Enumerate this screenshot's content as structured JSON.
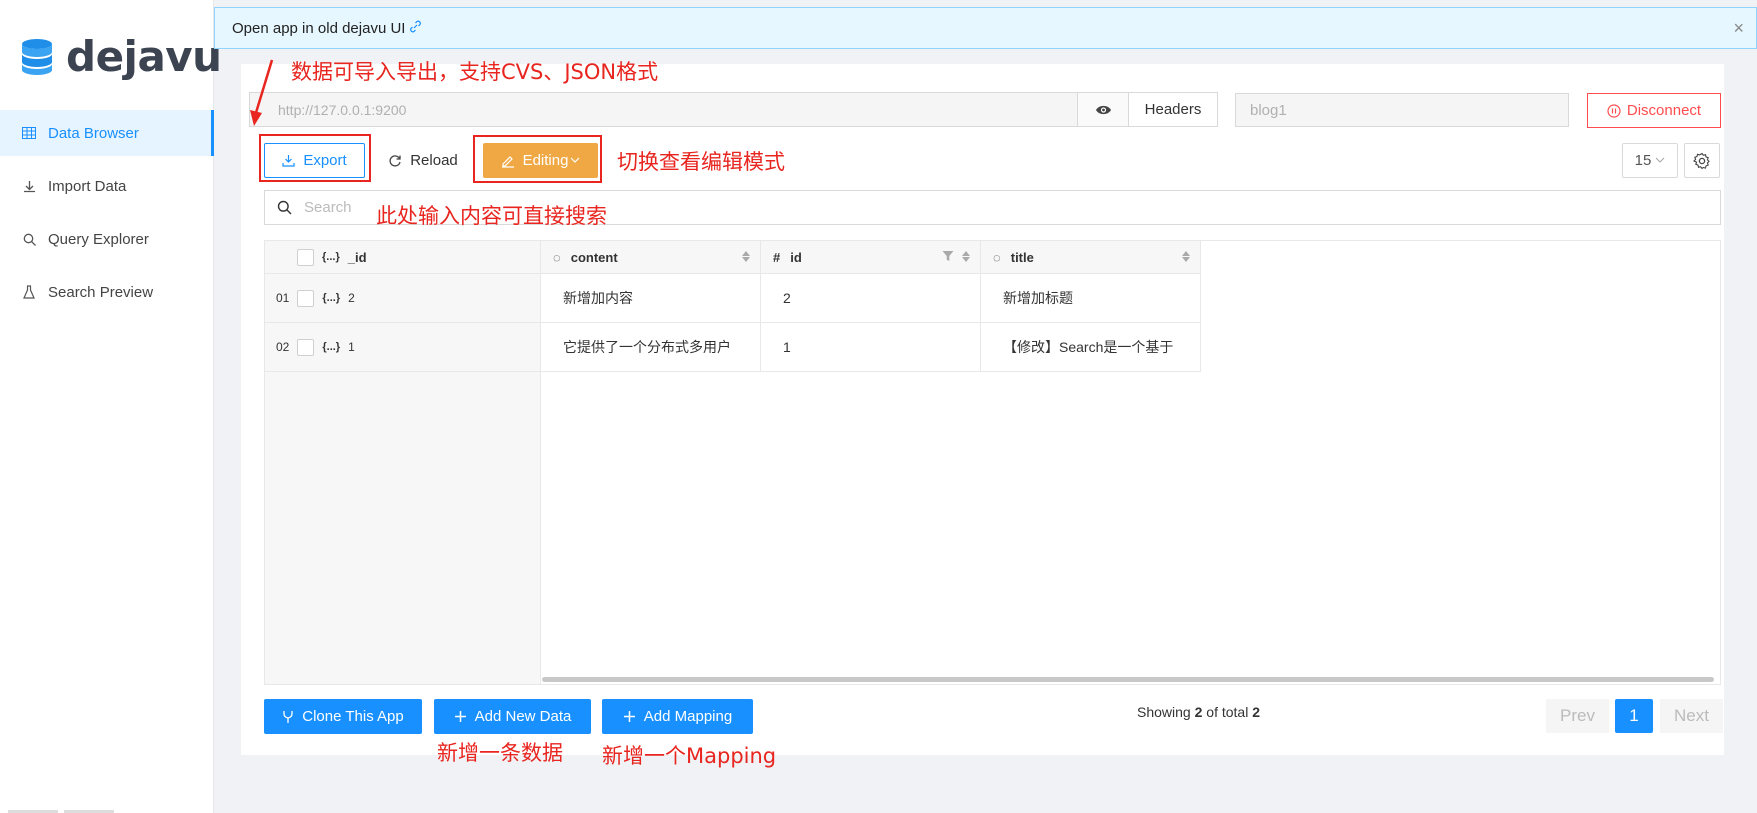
{
  "app": {
    "logo_text": "dejavu"
  },
  "sidebar": {
    "items": [
      {
        "label": "Data Browser",
        "icon": "table-icon",
        "active": true
      },
      {
        "label": "Import Data",
        "icon": "upload-icon"
      },
      {
        "label": "Query Explorer",
        "icon": "search-icon"
      },
      {
        "label": "Search Preview",
        "icon": "flask-icon"
      }
    ]
  },
  "alert": {
    "text": "Open app in old dejavu UI",
    "close": "×"
  },
  "connection": {
    "url_placeholder": "http://127.0.0.1:9200",
    "headers_label": "Headers",
    "app_name_placeholder": "blog1",
    "disconnect_label": "Disconnect"
  },
  "toolbar": {
    "export_label": "Export",
    "reload_label": "Reload",
    "editing_label": "Editing",
    "page_size": "15"
  },
  "search": {
    "placeholder": "Search"
  },
  "annotations": {
    "export_note": "数据可导入导出，支持CVS、JSON格式",
    "editing_note": "切换查看编辑模式",
    "search_note": "此处输入内容可直接搜索",
    "add_data_note": "新增一条数据",
    "add_mapping_note": "新增一个Mapping"
  },
  "table": {
    "id_header": "_id",
    "obj_tag": "{...}",
    "columns": [
      {
        "type_icon": "◌",
        "name": "content"
      },
      {
        "type_icon": "#",
        "name": "id"
      },
      {
        "type_icon": "◌",
        "name": "title"
      }
    ],
    "rows": [
      {
        "num": "01",
        "_id": "2",
        "content": "新增加内容",
        "id": "2",
        "title": "新增加标题"
      },
      {
        "num": "02",
        "_id": "1",
        "content": "它提供了一个分布式多用户",
        "id": "1",
        "title": "【修改】Search是一个基于"
      }
    ]
  },
  "footer": {
    "clone_label": "Clone This App",
    "add_data_label": "Add New Data",
    "add_mapping_label": "Add Mapping",
    "showing_prefix": "Showing ",
    "showing_count": "2",
    "showing_mid": " of total ",
    "showing_total": "2",
    "prev_label": "Prev",
    "page": "1",
    "next_label": "Next"
  },
  "colors": {
    "accent": "#1890ff",
    "danger": "#ff4d4f",
    "editing": "#f0a844",
    "annotation": "#e8251f"
  }
}
